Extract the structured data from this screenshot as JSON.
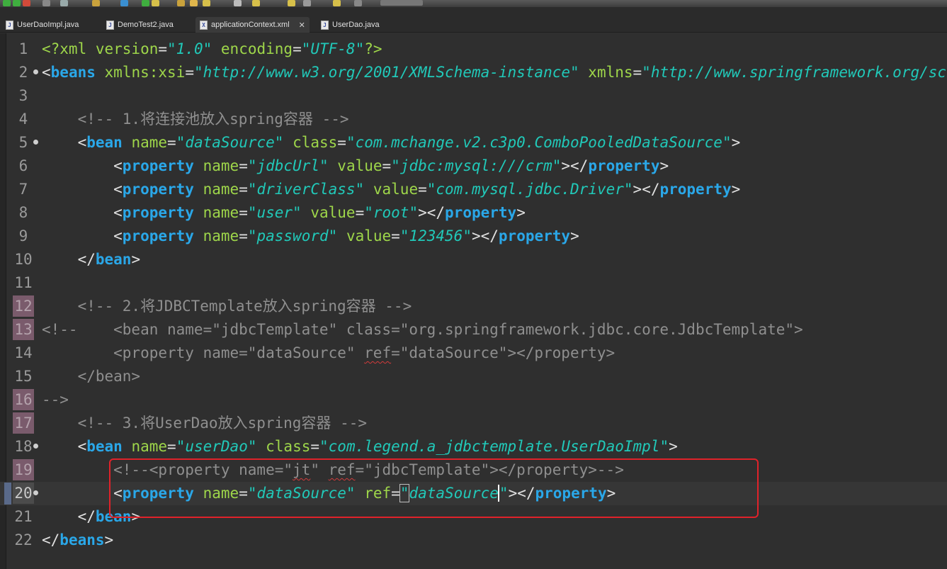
{
  "tabs": [
    {
      "label": "UserDaoImpl.java",
      "icon": "java-file-icon",
      "glyph": "J",
      "active": false
    },
    {
      "label": "DemoTest2.java",
      "icon": "java-file-icon",
      "glyph": "J",
      "active": false
    },
    {
      "label": "applicationContext.xml",
      "icon": "xml-file-icon",
      "glyph": "X",
      "active": true,
      "close": "✕"
    },
    {
      "label": "UserDao.java",
      "icon": "java-file-icon",
      "glyph": "J",
      "active": false
    }
  ],
  "colors": {
    "background": "#2f2f2f",
    "tag": "#2aa7e8",
    "attribute": "#9ed64a",
    "string": "#21c9b9",
    "comment": "#8f8f8f",
    "annotation_box": "#e0222a"
  },
  "lines": [
    {
      "n": "1",
      "tokens": [
        [
          "c-pi",
          "<?xml "
        ],
        [
          "c-attr",
          "version"
        ],
        [
          "c-punc",
          "="
        ],
        [
          "c-str",
          "\"1.0\""
        ],
        [
          "c-punc",
          " "
        ],
        [
          "c-attr",
          "encoding"
        ],
        [
          "c-punc",
          "="
        ],
        [
          "c-str",
          "\"UTF-8\""
        ],
        [
          "c-pi",
          "?>"
        ]
      ]
    },
    {
      "n": "2",
      "fold": true,
      "tokens": [
        [
          "c-punc",
          "<"
        ],
        [
          "c-tag",
          "beans"
        ],
        [
          "c-punc",
          " "
        ],
        [
          "c-attr",
          "xmlns:xsi"
        ],
        [
          "c-punc",
          "="
        ],
        [
          "c-str",
          "\"http://www.w3.org/2001/XMLSchema-instance\""
        ],
        [
          "c-punc",
          " "
        ],
        [
          "c-attr",
          "xmlns"
        ],
        [
          "c-punc",
          "="
        ],
        [
          "c-str",
          "\"http://www.springframework.org/schema/beans\""
        ]
      ]
    },
    {
      "n": "3",
      "tokens": []
    },
    {
      "n": "4",
      "tokens": [
        [
          "c-cmt",
          "    <!-- 1.将连接池放入spring容器 -->"
        ]
      ]
    },
    {
      "n": "5",
      "fold": true,
      "tokens": [
        [
          "c-punc",
          "    <"
        ],
        [
          "c-tag",
          "bean"
        ],
        [
          "c-punc",
          " "
        ],
        [
          "c-attr",
          "name"
        ],
        [
          "c-punc",
          "="
        ],
        [
          "c-str",
          "\"dataSource\""
        ],
        [
          "c-punc",
          " "
        ],
        [
          "c-attr",
          "class"
        ],
        [
          "c-punc",
          "="
        ],
        [
          "c-str",
          "\"com.mchange.v2.c3p0.ComboPooledDataSource\""
        ],
        [
          "c-punc",
          ">"
        ]
      ]
    },
    {
      "n": "6",
      "tokens": [
        [
          "c-punc",
          "        <"
        ],
        [
          "c-tag",
          "property"
        ],
        [
          "c-punc",
          " "
        ],
        [
          "c-attr",
          "name"
        ],
        [
          "c-punc",
          "="
        ],
        [
          "c-str",
          "\"jdbcUrl\""
        ],
        [
          "c-punc",
          " "
        ],
        [
          "c-attr",
          "value"
        ],
        [
          "c-punc",
          "="
        ],
        [
          "c-str",
          "\"jdbc:mysql:///crm\""
        ],
        [
          "c-punc",
          "></"
        ],
        [
          "c-tag",
          "property"
        ],
        [
          "c-punc",
          ">"
        ]
      ]
    },
    {
      "n": "7",
      "tokens": [
        [
          "c-punc",
          "        <"
        ],
        [
          "c-tag",
          "property"
        ],
        [
          "c-punc",
          " "
        ],
        [
          "c-attr",
          "name"
        ],
        [
          "c-punc",
          "="
        ],
        [
          "c-str",
          "\"driverClass\""
        ],
        [
          "c-punc",
          " "
        ],
        [
          "c-attr",
          "value"
        ],
        [
          "c-punc",
          "="
        ],
        [
          "c-str",
          "\"com.mysql.jdbc.Driver\""
        ],
        [
          "c-punc",
          "></"
        ],
        [
          "c-tag",
          "property"
        ],
        [
          "c-punc",
          ">"
        ]
      ]
    },
    {
      "n": "8",
      "tokens": [
        [
          "c-punc",
          "        <"
        ],
        [
          "c-tag",
          "property"
        ],
        [
          "c-punc",
          " "
        ],
        [
          "c-attr",
          "name"
        ],
        [
          "c-punc",
          "="
        ],
        [
          "c-str",
          "\"user\""
        ],
        [
          "c-punc",
          " "
        ],
        [
          "c-attr",
          "value"
        ],
        [
          "c-punc",
          "="
        ],
        [
          "c-str",
          "\"root\""
        ],
        [
          "c-punc",
          "></"
        ],
        [
          "c-tag",
          "property"
        ],
        [
          "c-punc",
          ">"
        ]
      ]
    },
    {
      "n": "9",
      "tokens": [
        [
          "c-punc",
          "        <"
        ],
        [
          "c-tag",
          "property"
        ],
        [
          "c-punc",
          " "
        ],
        [
          "c-attr",
          "name"
        ],
        [
          "c-punc",
          "="
        ],
        [
          "c-str",
          "\"password\""
        ],
        [
          "c-punc",
          " "
        ],
        [
          "c-attr",
          "value"
        ],
        [
          "c-punc",
          "="
        ],
        [
          "c-str",
          "\"123456\""
        ],
        [
          "c-punc",
          "></"
        ],
        [
          "c-tag",
          "property"
        ],
        [
          "c-punc",
          ">"
        ]
      ]
    },
    {
      "n": "10",
      "tokens": [
        [
          "c-punc",
          "    </"
        ],
        [
          "c-tag",
          "bean"
        ],
        [
          "c-punc",
          ">"
        ]
      ]
    },
    {
      "n": "11",
      "tokens": []
    },
    {
      "n": "12",
      "hl": true,
      "tokens": [
        [
          "c-cmt",
          "    <!-- 2.将JDBCTemplate放入spring容器 -->"
        ]
      ]
    },
    {
      "n": "13",
      "hl": true,
      "tokens": [
        [
          "c-cmt",
          "<!--    <bean name=\"jdbcTemplate\" class=\"org.springframework.jdbc.core.JdbcTemplate\">"
        ]
      ]
    },
    {
      "n": "14",
      "tokens": [
        [
          "c-cmt",
          "        <property name=\"dataSource\" "
        ],
        [
          "c-cmt squig",
          "ref"
        ],
        [
          "c-cmt",
          "=\"dataSource\"></property>"
        ]
      ]
    },
    {
      "n": "15",
      "tokens": [
        [
          "c-cmt",
          "    </bean>"
        ]
      ]
    },
    {
      "n": "16",
      "hl": true,
      "tokens": [
        [
          "c-cmt",
          "-->"
        ]
      ]
    },
    {
      "n": "17",
      "hl": true,
      "tokens": [
        [
          "c-cmt",
          "    <!-- 3.将UserDao放入spring容器 -->"
        ]
      ]
    },
    {
      "n": "18",
      "fold": true,
      "tokens": [
        [
          "c-punc",
          "    <"
        ],
        [
          "c-tag",
          "bean"
        ],
        [
          "c-punc",
          " "
        ],
        [
          "c-attr",
          "name"
        ],
        [
          "c-punc",
          "="
        ],
        [
          "c-str",
          "\"userDao\""
        ],
        [
          "c-punc",
          " "
        ],
        [
          "c-attr",
          "class"
        ],
        [
          "c-punc",
          "="
        ],
        [
          "c-str",
          "\"com.legend.a_jdbctemplate.UserDaoImpl\""
        ],
        [
          "c-punc",
          ">"
        ]
      ]
    },
    {
      "n": "19",
      "hl": true,
      "tokens": [
        [
          "c-cmt",
          "        <!--<property name=\""
        ],
        [
          "c-cmt squig",
          "jt"
        ],
        [
          "c-cmt",
          "\" "
        ],
        [
          "c-cmt squig",
          "ref"
        ],
        [
          "c-cmt",
          "=\"jdbcTemplate\"></property>-->"
        ]
      ]
    },
    {
      "n": "20",
      "cur": true,
      "fold": true,
      "tokens": [
        [
          "c-punc",
          "        <"
        ],
        [
          "c-tag",
          "property"
        ],
        [
          "c-punc",
          " "
        ],
        [
          "c-attr",
          "name"
        ],
        [
          "c-punc",
          "="
        ],
        [
          "c-str",
          "\"dataSource\""
        ],
        [
          "c-punc",
          " "
        ],
        [
          "c-attr",
          "ref"
        ],
        [
          "c-punc",
          "="
        ],
        [
          "c-str bracket-box",
          "\""
        ],
        [
          "c-str",
          "dataSource"
        ],
        [
          "c-str caret",
          "\""
        ],
        [
          "c-punc",
          "></"
        ],
        [
          "c-tag",
          "property"
        ],
        [
          "c-punc",
          ">"
        ]
      ]
    },
    {
      "n": "21",
      "tokens": [
        [
          "c-punc",
          "    </"
        ],
        [
          "c-tag",
          "bean"
        ],
        [
          "c-punc",
          ">"
        ]
      ]
    },
    {
      "n": "22",
      "tokens": [
        [
          "c-punc",
          "</"
        ],
        [
          "c-tag",
          "beans"
        ],
        [
          "c-punc",
          ">"
        ]
      ]
    }
  ]
}
